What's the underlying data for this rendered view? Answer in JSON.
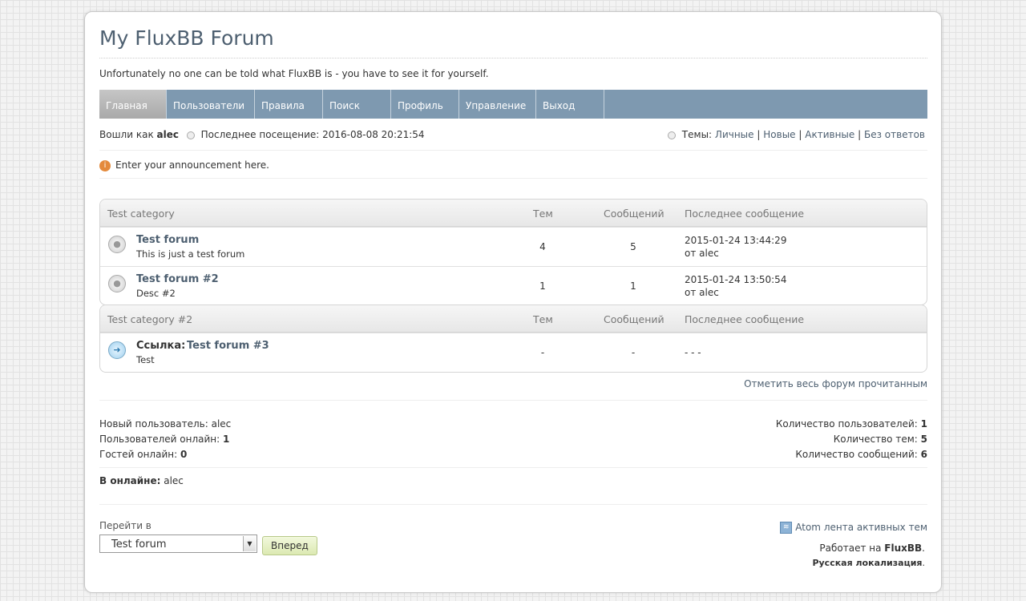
{
  "header": {
    "title": "My FluxBB Forum",
    "description": "Unfortunately no one can be told what FluxBB is - you have to see it for yourself."
  },
  "nav": {
    "items": [
      {
        "label": "Главная"
      },
      {
        "label": "Пользователи"
      },
      {
        "label": "Правила"
      },
      {
        "label": "Поиск"
      },
      {
        "label": "Профиль"
      },
      {
        "label": "Управление"
      },
      {
        "label": "Выход"
      }
    ]
  },
  "status": {
    "logged_prefix": "Вошли как",
    "username": "alec",
    "last_visit": "Последнее посещение: 2016-08-08 20:21:54",
    "topics_label": "Темы:",
    "links": [
      "Личные",
      "Новые",
      "Активные",
      "Без ответов"
    ],
    "sep": "|"
  },
  "announcement": "Enter your announcement here.",
  "columns": {
    "topics": "Тем",
    "posts": "Сообщений",
    "last": "Последнее сообщение"
  },
  "categories": [
    {
      "name": "Test category",
      "forums": [
        {
          "name": "Test forum",
          "desc": "This is just a test forum",
          "topics": "4",
          "posts": "5",
          "last_date": "2015-01-24 13:44:29",
          "last_by": "от alec"
        },
        {
          "name": "Test forum #2",
          "desc": "Desc #2",
          "topics": "1",
          "posts": "1",
          "last_date": "2015-01-24 13:50:54",
          "last_by": "от alec"
        }
      ]
    },
    {
      "name": "Test category #2",
      "forums": [
        {
          "prefix": "Ссылка:",
          "name": "Test forum #3",
          "desc": "Test",
          "topics": "-",
          "posts": "-",
          "last_date": "- - -"
        }
      ]
    }
  ],
  "mark_read": "Отметить весь форум прочитанным",
  "stats": {
    "newest_label": "Новый пользователь:",
    "newest": "alec",
    "users_online_label": "Пользователей онлайн:",
    "users_online": "1",
    "guests_online_label": "Гостей онлайн:",
    "guests_online": "0",
    "total_users_label": "Количество пользователей:",
    "total_users": "1",
    "total_topics_label": "Количество тем:",
    "total_topics": "5",
    "total_posts_label": "Количество сообщений:",
    "total_posts": "6"
  },
  "online": {
    "label": "В онлайне:",
    "users": "alec"
  },
  "footer": {
    "jump_label": "Перейти в",
    "jump_selected": "Test forum",
    "go_button": "Вперед",
    "feed_label": "Atom лента активных тем",
    "powered_prefix": "Работает на",
    "powered_name": "FluxBB",
    "localization": "Русская локализация"
  }
}
